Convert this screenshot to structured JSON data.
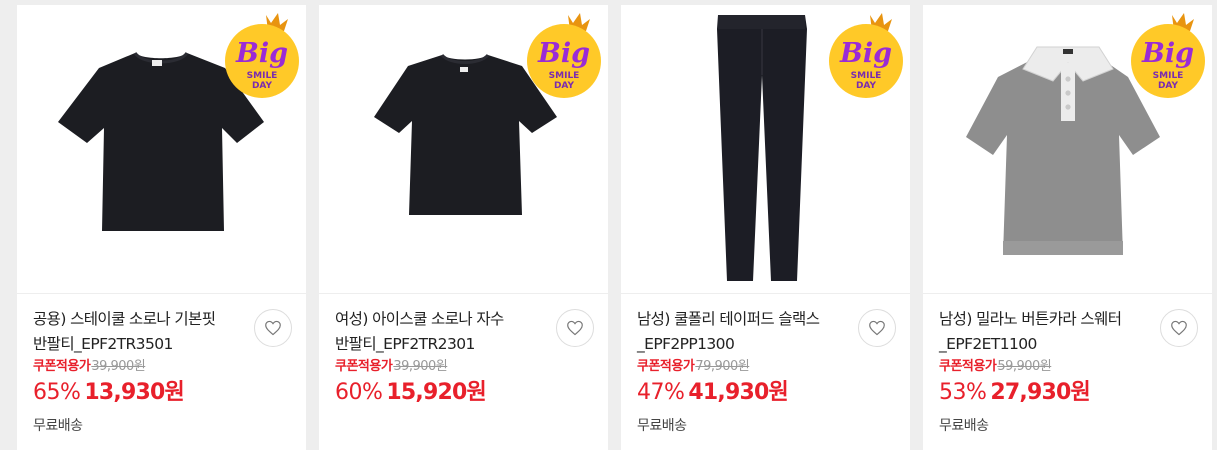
{
  "badge": {
    "big": "Big",
    "smile": "SMILE",
    "day": "DAY"
  },
  "products": [
    {
      "title": "공용) 스테이쿨 소로나 기본핏\n반팔티_EPF2TR3501",
      "coupon_label": "쿠폰적용가",
      "original_price": "39,900원",
      "discount": "65%",
      "sale_price": "13,930원",
      "shipping": "무료배송",
      "image_icon": "black-tshirt"
    },
    {
      "title": "여성) 아이스쿨 소로나 자수\n반팔티_EPF2TR2301",
      "coupon_label": "쿠폰적용가",
      "original_price": "39,900원",
      "discount": "60%",
      "sale_price": "15,920원",
      "shipping": "",
      "image_icon": "black-tshirt"
    },
    {
      "title": "남성) 쿨폴리 테이퍼드 슬랙스\n_EPF2PP1300",
      "coupon_label": "쿠폰적용가",
      "original_price": "79,900원",
      "discount": "47%",
      "sale_price": "41,930원",
      "shipping": "무료배송",
      "image_icon": "black-slacks"
    },
    {
      "title": "남성) 밀라노 버튼카라 스웨터\n_EPF2ET1100",
      "coupon_label": "쿠폰적용가",
      "original_price": "59,900원",
      "discount": "53%",
      "sale_price": "27,930원",
      "shipping": "무료배송",
      "image_icon": "gray-polo-sweater"
    }
  ],
  "colors": {
    "accent_red": "#e8202b",
    "badge_yellow": "#ffc928",
    "badge_purple": "#9a2bd6"
  }
}
